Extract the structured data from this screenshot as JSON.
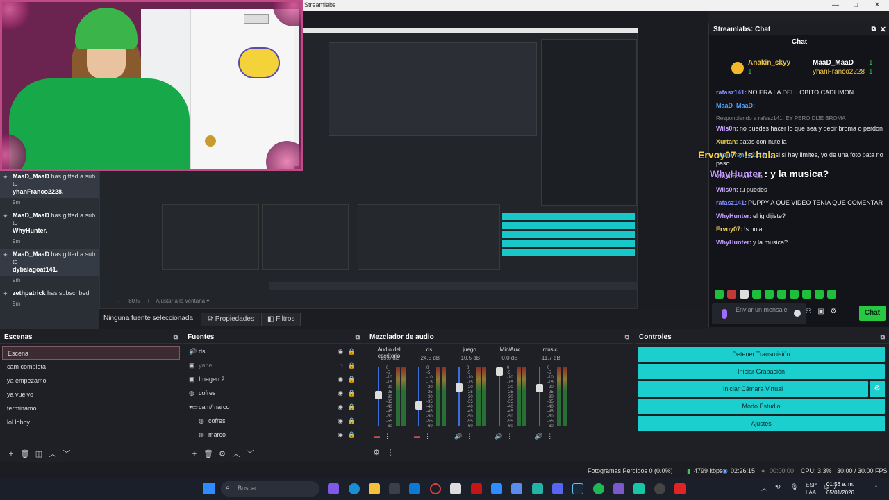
{
  "window": {
    "title": "Streamlabs"
  },
  "feed": {
    "items": [
      {
        "user": "MaaD_MaaD",
        "text": "has gifted a sub to",
        "target": "yhanFranco2228.",
        "time": "9m"
      },
      {
        "user": "MaaD_MaaD",
        "text": "has gifted a sub to",
        "target": "WhyHunter.",
        "time": "9m"
      },
      {
        "user": "MaaD_MaaD",
        "text": "has gifted a sub to",
        "target": "dybalagoat141.",
        "time": "9m"
      },
      {
        "user": "zethpatrick",
        "text": "has subscribed",
        "target": "",
        "time": "9m"
      }
    ]
  },
  "preview": {
    "zoom": "80%",
    "zoom_fit": "Ajustar a la ventana",
    "overlay_line1": "Ervoy07 : !s hola",
    "overlay_line2_user": "WhyHunter",
    "overlay_line2_text": " : y la musica?"
  },
  "props_row": {
    "no_source": "Ninguna fuente seleccionada",
    "properties": "Propiedades",
    "filters": "Filtros"
  },
  "chat": {
    "window_title": "Streamlabs: Chat",
    "subtitle": "Chat",
    "donors": [
      {
        "name": "Anakin_skyy",
        "count": "1"
      },
      {
        "name": "MaaD_MaaD",
        "count": "1"
      },
      {
        "name": "yhanFranco2228",
        "count": "1"
      }
    ],
    "messages": [
      {
        "user": "rafasz141:",
        "text": "NO ERA LA DEL LOBITO CADLIMON",
        "color": "#7e8cff"
      },
      {
        "user": "MaaD_MaaD:",
        "text": "",
        "color": "#4aa3ff"
      },
      {
        "user": "",
        "text": "Respondiendo a rafasz141: EY PERO DIJE BROMA",
        "color": "#888888",
        "reply": true
      },
      {
        "user": "Wils0n:",
        "text": "no puedes hacer lo que sea y decir broma o perdon",
        "color": "#c9a4ff"
      },
      {
        "user": "Xurtan:",
        "text": "patas con nutella",
        "color": "#d9c24a"
      },
      {
        "user": "yhanFranco2228:",
        "text": "Is si si hay limites, yo de una foto pata no paso.",
        "color": "#4aa3ff"
      },
      {
        "user": "Wils0n:",
        "text": "dale tilin",
        "color": "#c9a4ff"
      },
      {
        "user": "Wils0n:",
        "text": "tu puedes",
        "color": "#c9a4ff"
      },
      {
        "user": "rafasz141:",
        "text": "PUPPY A QUE VIDEO TENIA QUE COMENTAR",
        "color": "#7e8cff"
      },
      {
        "user": "WhyHunter:",
        "text": "el ig dijiste?",
        "color": "#c49bff"
      },
      {
        "user": "Ervoy07:",
        "text": "!s hola",
        "color": "#f2d35a"
      },
      {
        "user": "WhyHunter:",
        "text": "y la musica?",
        "color": "#c49bff"
      }
    ],
    "input_placeholder": "Enviar un mensaje",
    "send_label": "Chat"
  },
  "scenes": {
    "title": "Escenas",
    "items": [
      "Escena",
      "cam completa",
      "ya empezamo",
      "ya vuelvo",
      "terminamo",
      "lol lobby"
    ],
    "selected": "Escena"
  },
  "sources": {
    "title": "Fuentes",
    "items": [
      {
        "label": "ds",
        "icon": "audio-icon",
        "dim": false,
        "indent": 0
      },
      {
        "label": "yape",
        "icon": "image-icon",
        "dim": true,
        "indent": 0
      },
      {
        "label": "Imagen 2",
        "icon": "image-icon",
        "dim": false,
        "indent": 0
      },
      {
        "label": "cofres",
        "icon": "browser-icon",
        "dim": false,
        "indent": 0
      },
      {
        "label": "cam/marco",
        "icon": "folder-icon",
        "dim": false,
        "indent": 0
      },
      {
        "label": "cofres",
        "icon": "browser-icon",
        "dim": false,
        "indent": 1
      },
      {
        "label": "marco",
        "icon": "browser-icon",
        "dim": false,
        "indent": 1
      }
    ]
  },
  "mixer": {
    "title": "Mezclador de audio",
    "channels": [
      {
        "name": "Audio del escritorio",
        "db": "-15.6 dB",
        "level": 0.55,
        "muted": true
      },
      {
        "name": "ds",
        "db": "-24.5 dB",
        "level": 0.35,
        "muted": true
      },
      {
        "name": "juego",
        "db": "-10.5 dB",
        "level": 0.7,
        "muted": false
      },
      {
        "name": "Mic/Aux",
        "db": "0.0 dB",
        "level": 1.0,
        "muted": false
      },
      {
        "name": "music",
        "db": "-11.7 dB",
        "level": 0.68,
        "muted": false
      }
    ],
    "scale": [
      "0",
      "-5",
      "-10",
      "-15",
      "-20",
      "-25",
      "-30",
      "-35",
      "-40",
      "-45",
      "-50",
      "-55",
      "-60"
    ]
  },
  "controls": {
    "title": "Controles",
    "buttons": [
      "Detener Transmisión",
      "Iniciar Grabación",
      "Iniciar Cámara Virtual",
      "Modo Estudio",
      "Ajustes"
    ]
  },
  "status": {
    "dropped": "Fotogramas Perdidos 0 (0.0%)",
    "bitrate": "4799 kbps",
    "stream_time": "02:26:15",
    "rec_time": "00:00:00",
    "cpu": "CPU: 3.3%",
    "fps": "30.00 / 30.00 FPS"
  },
  "taskbar": {
    "search": "Buscar",
    "lang1": "ESP",
    "lang2": "LAA",
    "time": "01:56 a. m.",
    "date": "05/01/2026"
  }
}
